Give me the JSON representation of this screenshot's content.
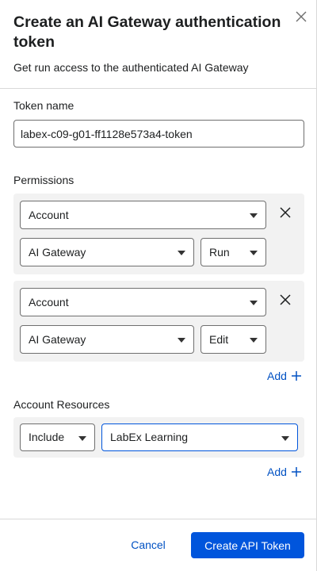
{
  "dialog": {
    "title": "Create an AI Gateway authentication token",
    "subtitle": "Get run access to the authenticated AI Gateway",
    "close_icon": "close-icon"
  },
  "token_name": {
    "label": "Token name",
    "value": "labex-c09-g01-ff1128e573a4-token"
  },
  "permissions": {
    "label": "Permissions",
    "rows": [
      {
        "scope": "Account",
        "resource": "AI Gateway",
        "level": "Run"
      },
      {
        "scope": "Account",
        "resource": "AI Gateway",
        "level": "Edit"
      }
    ],
    "add_label": "Add"
  },
  "account_resources": {
    "label": "Account Resources",
    "mode": "Include",
    "account": "LabEx Learning",
    "add_label": "Add"
  },
  "footer": {
    "cancel_label": "Cancel",
    "submit_label": "Create API Token"
  },
  "colors": {
    "primary": "#0055dc",
    "link": "#0051c3",
    "block_bg": "#f2f2f2"
  }
}
